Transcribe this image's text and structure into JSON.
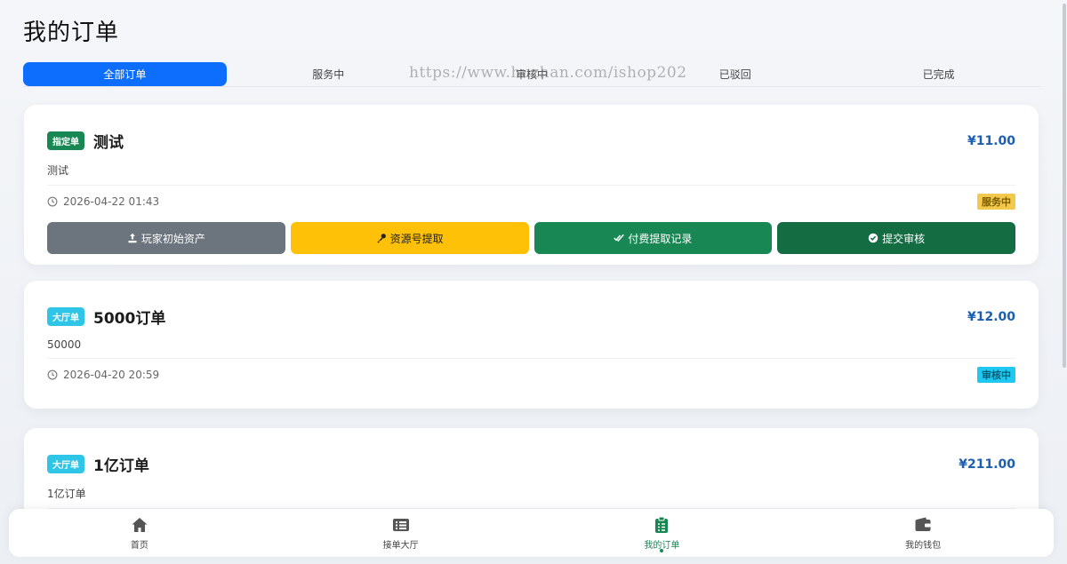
{
  "page": {
    "title": "我的订单",
    "watermark": "https://www.huzhan.com/ishop202"
  },
  "tabs": [
    {
      "label": "全部订单",
      "active": true
    },
    {
      "label": "服务中"
    },
    {
      "label": "审核中"
    },
    {
      "label": "已驳回"
    },
    {
      "label": "已完成"
    }
  ],
  "orders": [
    {
      "type_label": "指定单",
      "type_color": "#198754",
      "title": "测试",
      "price": "¥11.00",
      "desc": "测试",
      "time": "2026-04-22 01:43",
      "status": "服务中",
      "status_bg": "#f2c94c",
      "status_color": "#7a5a00",
      "actions": [
        {
          "label": "玩家初始资产",
          "icon": "upload-icon",
          "color": "#6c757d"
        },
        {
          "label": "资源号提取",
          "icon": "key-icon",
          "color": "#ffc107"
        },
        {
          "label": "付费提取记录",
          "icon": "check-double-icon",
          "color": "#198754"
        },
        {
          "label": "提交审核",
          "icon": "check-circle-icon",
          "color": "#146c43"
        }
      ]
    },
    {
      "type_label": "大厅单",
      "type_color": "#2ec5e6",
      "title": "5000订单",
      "price": "¥12.00",
      "desc": "50000",
      "time": "2026-04-20 20:59",
      "status": "审核中",
      "status_bg": "#1fc8f0",
      "status_color": "#0b5d75"
    },
    {
      "type_label": "大厅单",
      "type_color": "#2ec5e6",
      "title": "1亿订单",
      "price": "¥211.00",
      "desc": "1亿订单"
    }
  ],
  "nav": [
    {
      "label": "首页",
      "icon": "home-icon"
    },
    {
      "label": "接单大厅",
      "icon": "list-icon"
    },
    {
      "label": "我的订单",
      "icon": "clipboard-icon",
      "active": true
    },
    {
      "label": "我的钱包",
      "icon": "wallet-icon"
    }
  ]
}
